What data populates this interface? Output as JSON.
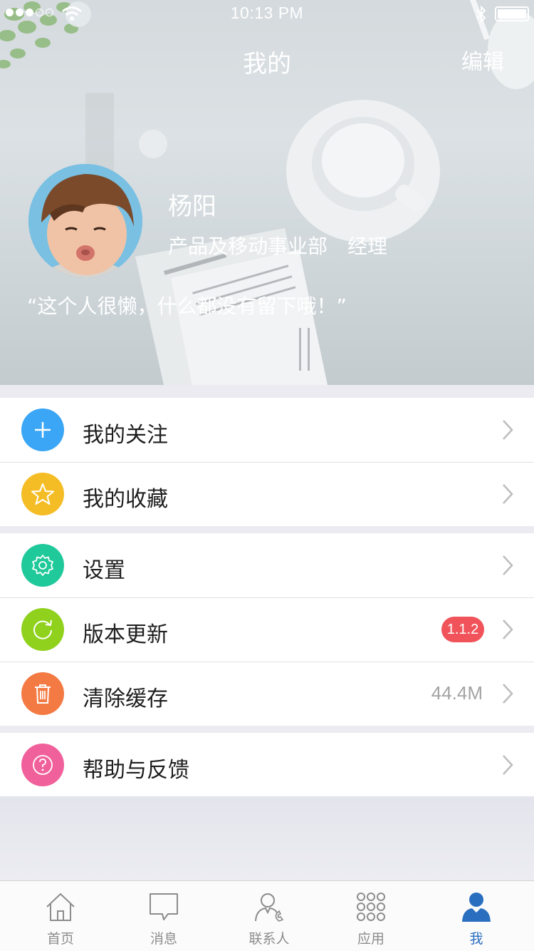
{
  "status_bar": {
    "time": "10:13 PM"
  },
  "header": {
    "title": "我的",
    "edit_label": "编辑"
  },
  "profile": {
    "name": "杨阳",
    "department": "产品及移动事业部",
    "position": "经理",
    "signature": "“这个人很懒，什么都没有留下哦！”"
  },
  "menu": {
    "groups": [
      [
        {
          "label": "我的关注",
          "icon": "plus-icon",
          "color": "#3aa6f5"
        },
        {
          "label": "我的收藏",
          "icon": "star-icon",
          "color": "#f5bd25"
        }
      ],
      [
        {
          "label": "设置",
          "icon": "gear-icon",
          "color": "#20c99a"
        },
        {
          "label": "版本更新",
          "icon": "refresh-icon",
          "color": "#8fd11d",
          "badge": "1.1.2"
        },
        {
          "label": "清除缓存",
          "icon": "trash-icon",
          "color": "#f47a43",
          "value": "44.4M"
        }
      ],
      [
        {
          "label": "帮助与反馈",
          "icon": "question-icon",
          "color": "#f0609b"
        }
      ]
    ]
  },
  "tabbar": {
    "items": [
      {
        "label": "首页",
        "icon": "home-icon"
      },
      {
        "label": "消息",
        "icon": "message-icon"
      },
      {
        "label": "联系人",
        "icon": "contacts-icon"
      },
      {
        "label": "应用",
        "icon": "apps-icon"
      },
      {
        "label": "我",
        "icon": "user-icon",
        "active": true
      }
    ],
    "active_color": "#2a6ebf",
    "inactive_color": "#8c8c8c"
  }
}
